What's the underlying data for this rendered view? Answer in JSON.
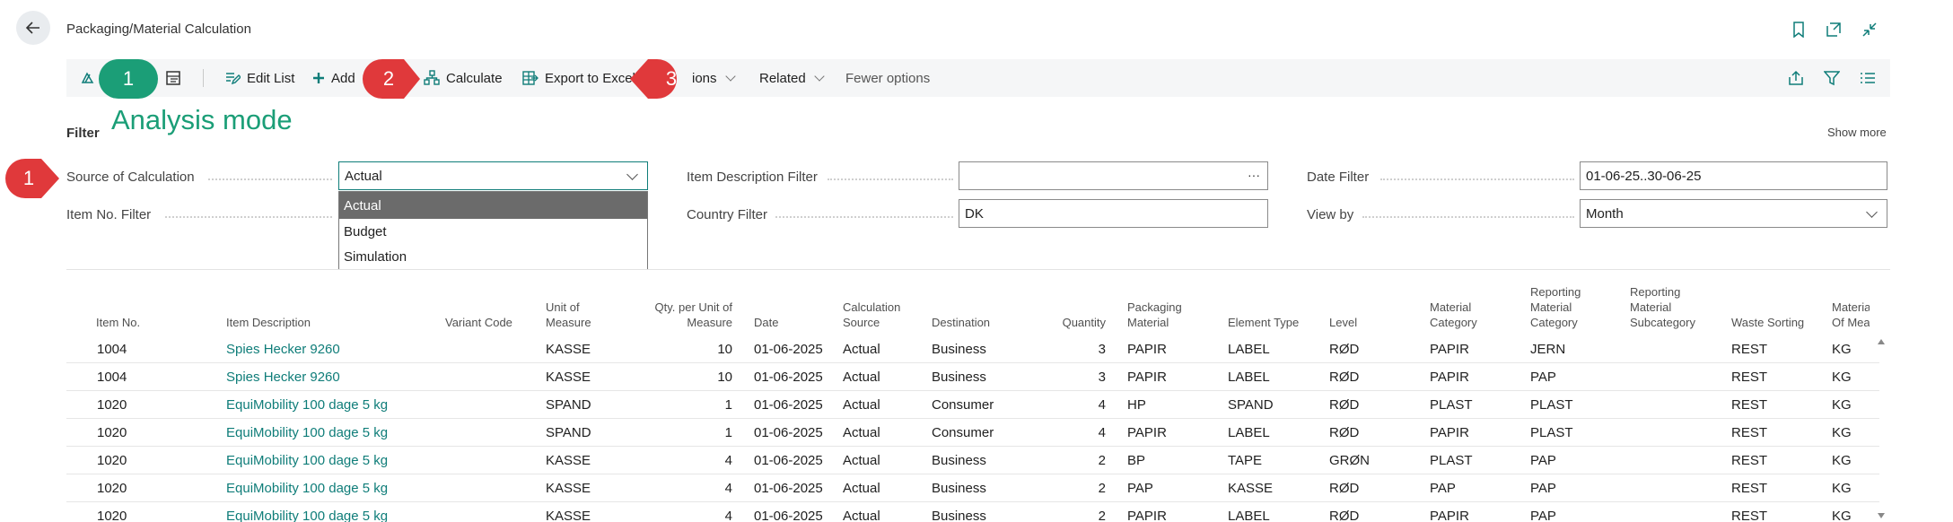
{
  "header": {
    "title": "Packaging/Material Calculation"
  },
  "actions": {
    "edit_list": "Edit List",
    "add": "Add",
    "calculate": "Calculate",
    "export": "Export to Excel",
    "options": "ions",
    "related": "Related",
    "fewer": "Fewer options"
  },
  "callouts": {
    "one": "1",
    "two": "2",
    "three": "3",
    "filter_one": "1",
    "analysis_label": "Analysis mode",
    "green": "#1b9e77",
    "red": "#e0393b"
  },
  "filter": {
    "title": "Filter",
    "show_more": "Show more",
    "source_label": "Source of Calculation",
    "source_value": "Actual",
    "source_options": [
      "Actual",
      "Budget",
      "Simulation"
    ],
    "item_no_label": "Item No. Filter",
    "item_desc_label": "Item Description Filter",
    "item_desc_value": "",
    "country_label": "Country Filter",
    "country_value": "DK",
    "date_label": "Date Filter",
    "date_value": "01-06-25..30-06-25",
    "view_by_label": "View by",
    "view_by_value": "Month"
  },
  "table": {
    "headers": {
      "item_no": "Item No.",
      "item_desc": "Item Description",
      "variant": "Variant Code",
      "uom_1": "Unit of",
      "uom_2": "Measure",
      "qpu_1": "Qty. per Unit of",
      "qpu_2": "Measure",
      "date": "Date",
      "calc_1": "Calculation",
      "calc_2": "Source",
      "dest": "Destination",
      "qty": "Quantity",
      "pm_1": "Packaging",
      "pm_2": "Material",
      "elem": "Element Type",
      "level": "Level",
      "mc_1": "Material",
      "mc_2": "Category",
      "rmc_1": "Reporting",
      "rmc_2": "Material",
      "rmc_3": "Category",
      "rms_1": "Reporting",
      "rms_2": "Material",
      "rms_3": "Subcategory",
      "waste": "Waste Sorting",
      "mu_1": "Material Ur",
      "mu_2": "Of Measure"
    },
    "rows": [
      {
        "item_no": "1004",
        "desc": "Spies Hecker 9260",
        "uom": "KASSE",
        "qpu": "10",
        "date": "01-06-2025",
        "src": "Actual",
        "dest": "Business",
        "qty": "3",
        "pm": "PAPIR",
        "elem": "LABEL",
        "level": "RØD",
        "mc": "PAPIR",
        "rmc": "JERN",
        "waste": "REST",
        "mu": "KG"
      },
      {
        "item_no": "1004",
        "desc": "Spies Hecker 9260",
        "uom": "KASSE",
        "qpu": "10",
        "date": "01-06-2025",
        "src": "Actual",
        "dest": "Business",
        "qty": "3",
        "pm": "PAPIR",
        "elem": "LABEL",
        "level": "RØD",
        "mc": "PAPIR",
        "rmc": "PAP",
        "waste": "REST",
        "mu": "KG"
      },
      {
        "item_no": "1020",
        "desc": "EquiMobility 100 dage 5 kg",
        "uom": "SPAND",
        "qpu": "1",
        "date": "01-06-2025",
        "src": "Actual",
        "dest": "Consumer",
        "qty": "4",
        "pm": "HP",
        "elem": "SPAND",
        "level": "RØD",
        "mc": "PLAST",
        "rmc": "PLAST",
        "waste": "REST",
        "mu": "KG"
      },
      {
        "item_no": "1020",
        "desc": "EquiMobility 100 dage 5 kg",
        "uom": "SPAND",
        "qpu": "1",
        "date": "01-06-2025",
        "src": "Actual",
        "dest": "Consumer",
        "qty": "4",
        "pm": "PAPIR",
        "elem": "LABEL",
        "level": "RØD",
        "mc": "PAPIR",
        "rmc": "PLAST",
        "waste": "REST",
        "mu": "KG"
      },
      {
        "item_no": "1020",
        "desc": "EquiMobility 100 dage 5 kg",
        "uom": "KASSE",
        "qpu": "4",
        "date": "01-06-2025",
        "src": "Actual",
        "dest": "Business",
        "qty": "2",
        "pm": "BP",
        "elem": "TAPE",
        "level": "GRØN",
        "mc": "PLAST",
        "rmc": "PAP",
        "waste": "REST",
        "mu": "KG"
      },
      {
        "item_no": "1020",
        "desc": "EquiMobility 100 dage 5 kg",
        "uom": "KASSE",
        "qpu": "4",
        "date": "01-06-2025",
        "src": "Actual",
        "dest": "Business",
        "qty": "2",
        "pm": "PAP",
        "elem": "KASSE",
        "level": "RØD",
        "mc": "PAP",
        "rmc": "PAP",
        "waste": "REST",
        "mu": "KG"
      },
      {
        "item_no": "1020",
        "desc": "EquiMobility 100 dage 5 kg",
        "uom": "KASSE",
        "qpu": "4",
        "date": "01-06-2025",
        "src": "Actual",
        "dest": "Business",
        "qty": "2",
        "pm": "PAPIR",
        "elem": "LABEL",
        "level": "RØD",
        "mc": "PAPIR",
        "rmc": "PAP",
        "waste": "REST",
        "mu": "KG"
      }
    ]
  }
}
